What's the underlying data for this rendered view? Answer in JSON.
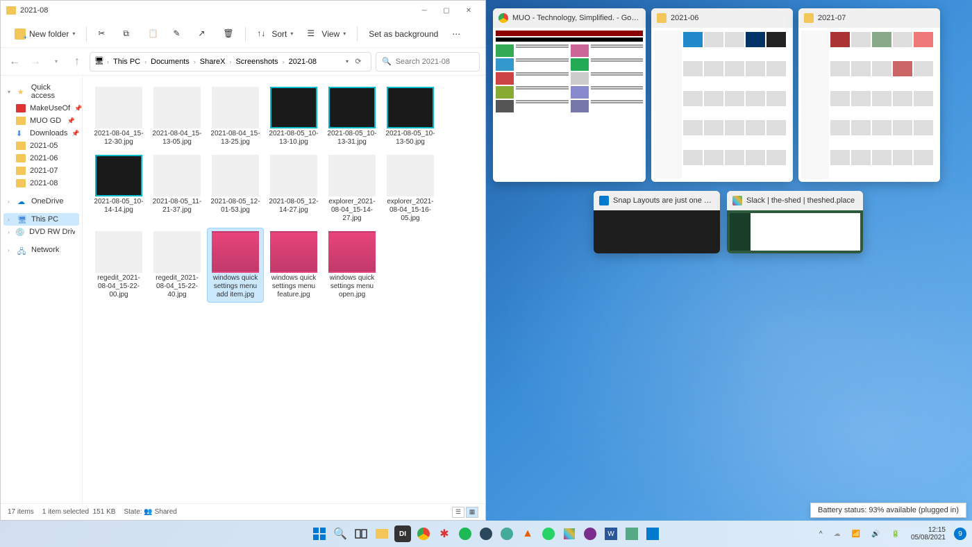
{
  "window": {
    "title": "2021-08"
  },
  "toolbar": {
    "new_folder": "New folder",
    "sort": "Sort",
    "view": "View",
    "set_background": "Set as background"
  },
  "breadcrumb": {
    "items": [
      "This PC",
      "Documents",
      "ShareX",
      "Screenshots",
      "2021-08"
    ]
  },
  "search": {
    "placeholder": "Search 2021-08"
  },
  "sidebar": {
    "quick_access": "Quick access",
    "pinned": [
      {
        "label": "MakeUseOf",
        "type": "red"
      },
      {
        "label": "MUO GD Scree",
        "type": "folder"
      },
      {
        "label": "Downloads",
        "type": "dl"
      },
      {
        "label": "2021-05",
        "type": "folder"
      },
      {
        "label": "2021-06",
        "type": "folder"
      },
      {
        "label": "2021-07",
        "type": "folder"
      },
      {
        "label": "2021-08",
        "type": "folder"
      }
    ],
    "onedrive": "OneDrive",
    "this_pc": "This PC",
    "dvd": "DVD RW Drive (D:) A",
    "network": "Network"
  },
  "files": [
    {
      "name": "2021-08-04_15-12-30.jpg",
      "style": "light"
    },
    {
      "name": "2021-08-04_15-13-05.jpg",
      "style": "light"
    },
    {
      "name": "2021-08-04_15-13-25.jpg",
      "style": "light"
    },
    {
      "name": "2021-08-05_10-13-10.jpg",
      "style": "dark"
    },
    {
      "name": "2021-08-05_10-13-31.jpg",
      "style": "dark"
    },
    {
      "name": "2021-08-05_10-13-50.jpg",
      "style": "dark"
    },
    {
      "name": "2021-08-05_10-14-14.jpg",
      "style": "dark"
    },
    {
      "name": "2021-08-05_11-21-37.jpg",
      "style": "light"
    },
    {
      "name": "2021-08-05_12-01-53.jpg",
      "style": "light"
    },
    {
      "name": "2021-08-05_12-14-27.jpg",
      "style": "light"
    },
    {
      "name": "explorer_2021-08-04_15-14-27.jpg",
      "style": "light"
    },
    {
      "name": "explorer_2021-08-04_15-16-05.jpg",
      "style": "light"
    },
    {
      "name": "regedit_2021-08-04_15-22-00.jpg",
      "style": "light"
    },
    {
      "name": "regedit_2021-08-04_15-22-40.jpg",
      "style": "light"
    },
    {
      "name": "windows quick settings menu add item.jpg",
      "style": "pink",
      "selected": true
    },
    {
      "name": "windows quick settings menu feature.jpg",
      "style": "pink"
    },
    {
      "name": "windows quick settings menu open.jpg",
      "style": "pink"
    }
  ],
  "status": {
    "items": "17 items",
    "selected": "1 item selected",
    "size": "151 KB",
    "state_label": "State:",
    "state_value": "Shared"
  },
  "snap": {
    "windows": [
      {
        "title": "MUO - Technology, Simplified. - Goog...",
        "icon": "chrome"
      },
      {
        "title": "2021-06",
        "icon": "folder"
      },
      {
        "title": "2021-07",
        "icon": "folder"
      }
    ],
    "row2": [
      {
        "title": "Snap Layouts are just one of...",
        "icon": "vscode"
      },
      {
        "title": "Slack | the-shed | theshed.place",
        "icon": "slack"
      }
    ]
  },
  "battery_tooltip": "Battery status: 93% available (plugged in)",
  "tray": {
    "time": "12:15",
    "date": "05/08/2021",
    "notif_count": "9"
  },
  "colors": {
    "accent": "#0078d4",
    "folder": "#f3c659",
    "selection": "#cce8ff"
  }
}
